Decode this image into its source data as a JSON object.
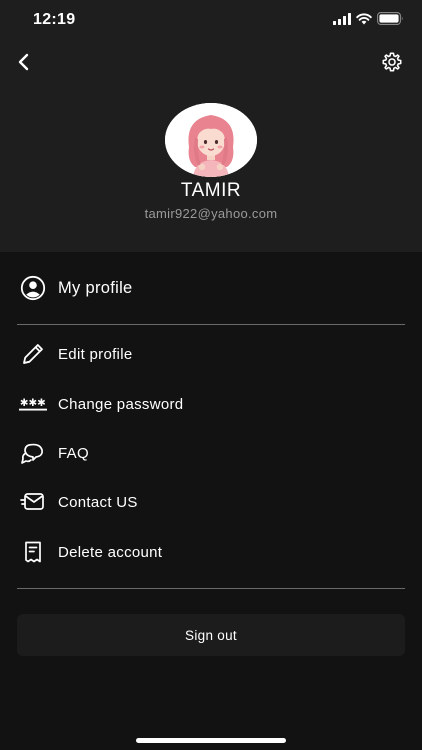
{
  "status_bar": {
    "time": "12:19",
    "icons": [
      "cellular-signal-icon",
      "wifi-icon",
      "battery-icon"
    ]
  },
  "header": {
    "back_icon": "chevron-left-icon",
    "settings_icon": "gear-icon",
    "user": {
      "name": "TAMIR",
      "email": "tamir922@yahoo.com"
    }
  },
  "menu": {
    "primary": {
      "label": "My profile",
      "icon": "user-circle-icon"
    },
    "items": [
      {
        "label": "Edit profile",
        "icon": "pencil-icon"
      },
      {
        "label": "Change password",
        "icon": "password-dots-icon"
      },
      {
        "label": "FAQ",
        "icon": "chat-bubbles-icon"
      },
      {
        "label": "Contact US",
        "icon": "envelope-icon"
      },
      {
        "label": "Delete account",
        "icon": "document-delete-icon"
      }
    ]
  },
  "sign_out": {
    "label": "Sign out"
  },
  "colors": {
    "background": "#121212",
    "header_background": "#1e1e1e",
    "text": "#ffffff",
    "muted_text": "#9a9a9a",
    "divider": "#6a6a6a",
    "button_background": "#1c1c1c"
  }
}
